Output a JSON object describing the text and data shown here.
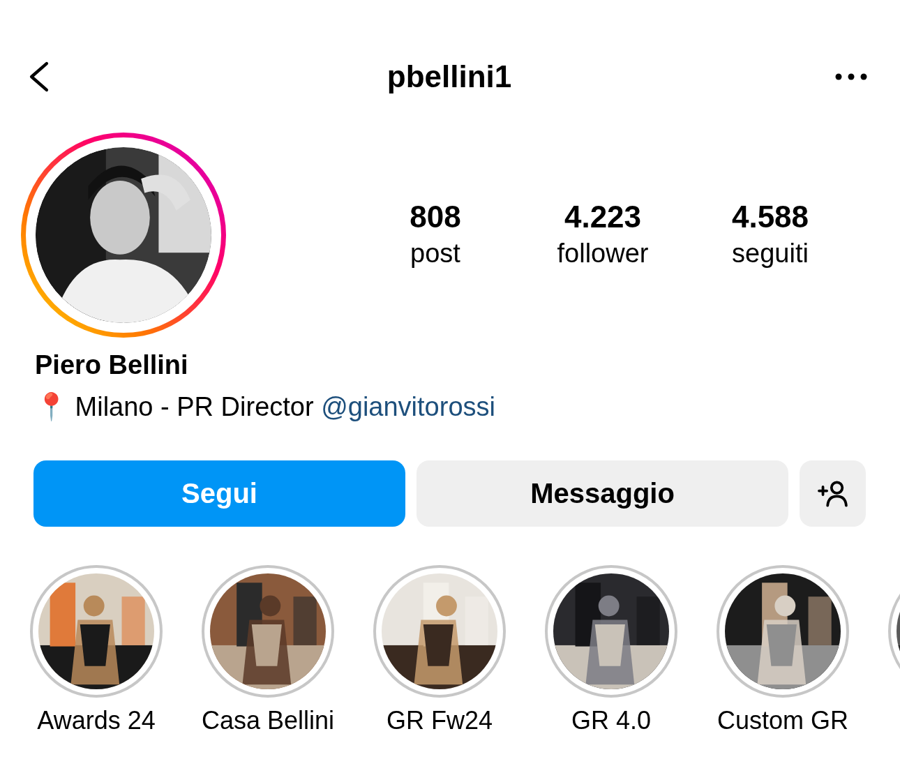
{
  "header": {
    "username": "pbellini1"
  },
  "profile": {
    "has_story": true,
    "name": "Piero Bellini",
    "bio_prefix": "📍 Milano - PR Director ",
    "bio_link": "@gianvitorossi"
  },
  "stats": [
    {
      "value": "808",
      "label": "post"
    },
    {
      "value": "4.223",
      "label": "follower"
    },
    {
      "value": "4.588",
      "label": "seguiti"
    }
  ],
  "buttons": [
    {
      "kind": "primary",
      "label": "Segui"
    },
    {
      "kind": "secondary",
      "label": "Messaggio"
    },
    {
      "kind": "icon"
    }
  ],
  "highlights": [
    {
      "kind": "story",
      "label": "Awards 24"
    },
    {
      "kind": "story",
      "label": "Casa Bellini"
    },
    {
      "kind": "story",
      "label": "GR Fw24"
    },
    {
      "kind": "story",
      "label": "GR 4.0"
    },
    {
      "kind": "story",
      "label": "Custom GR"
    },
    {
      "kind": "story"
    }
  ]
}
